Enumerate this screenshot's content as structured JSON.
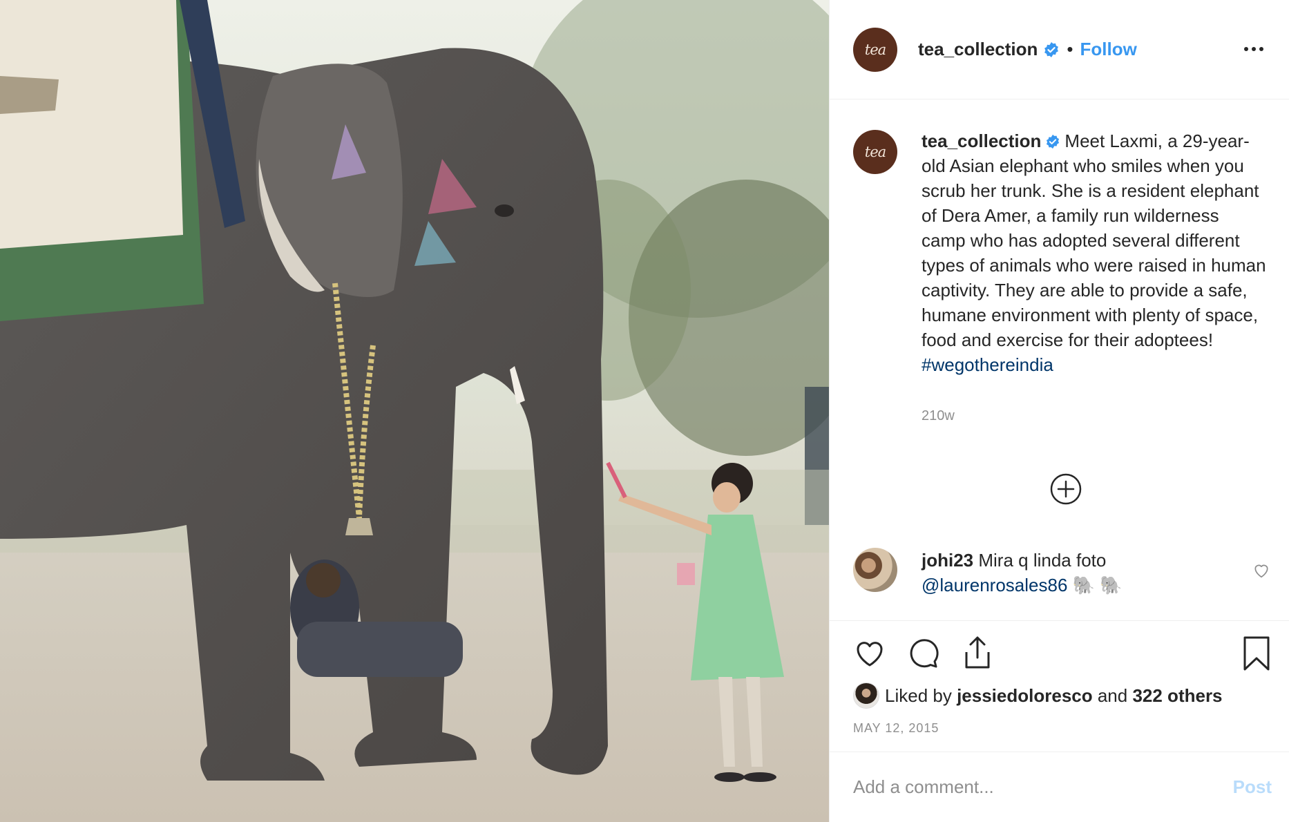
{
  "post": {
    "account": {
      "username": "tea_collection",
      "avatar_text": "tea",
      "verified": true,
      "follow_label": "Follow",
      "separator": "•"
    },
    "caption": {
      "username": "tea_collection",
      "text": "Meet Laxmi, a 29-year-old Asian elephant who smiles when you scrub her trunk. She is a resident elephant of Dera Amer, a family run wilderness camp who has adopted several different types of animals who were raised in human captivity. They are able to provide a safe, humane environment with plenty of space, food and exercise for their adoptees! ",
      "hashtag": "#wegothereindia",
      "time_ago": "210w"
    },
    "comments": [
      {
        "username": "johi23",
        "text": "Mira q linda foto ",
        "mention": "@laurenrosales86",
        "emoji": " 🐘 🐘"
      }
    ],
    "likes": {
      "prefix": "Liked by ",
      "liker": "jessiedoloresco",
      "middle": " and ",
      "others": "322 others"
    },
    "date": "MAY 12, 2015",
    "add_comment": {
      "placeholder": "Add a comment...",
      "post_label": "Post"
    }
  },
  "colors": {
    "link": "#3897f0",
    "hashtag": "#003569",
    "muted": "#8e8e8e",
    "brand_avatar": "#5a2e1d",
    "post_disabled": "#b9dcfb"
  },
  "icons": [
    "verified-badge-icon",
    "more-options-icon",
    "load-more-comments-icon",
    "heart-icon",
    "comment-icon",
    "share-icon",
    "bookmark-icon"
  ]
}
